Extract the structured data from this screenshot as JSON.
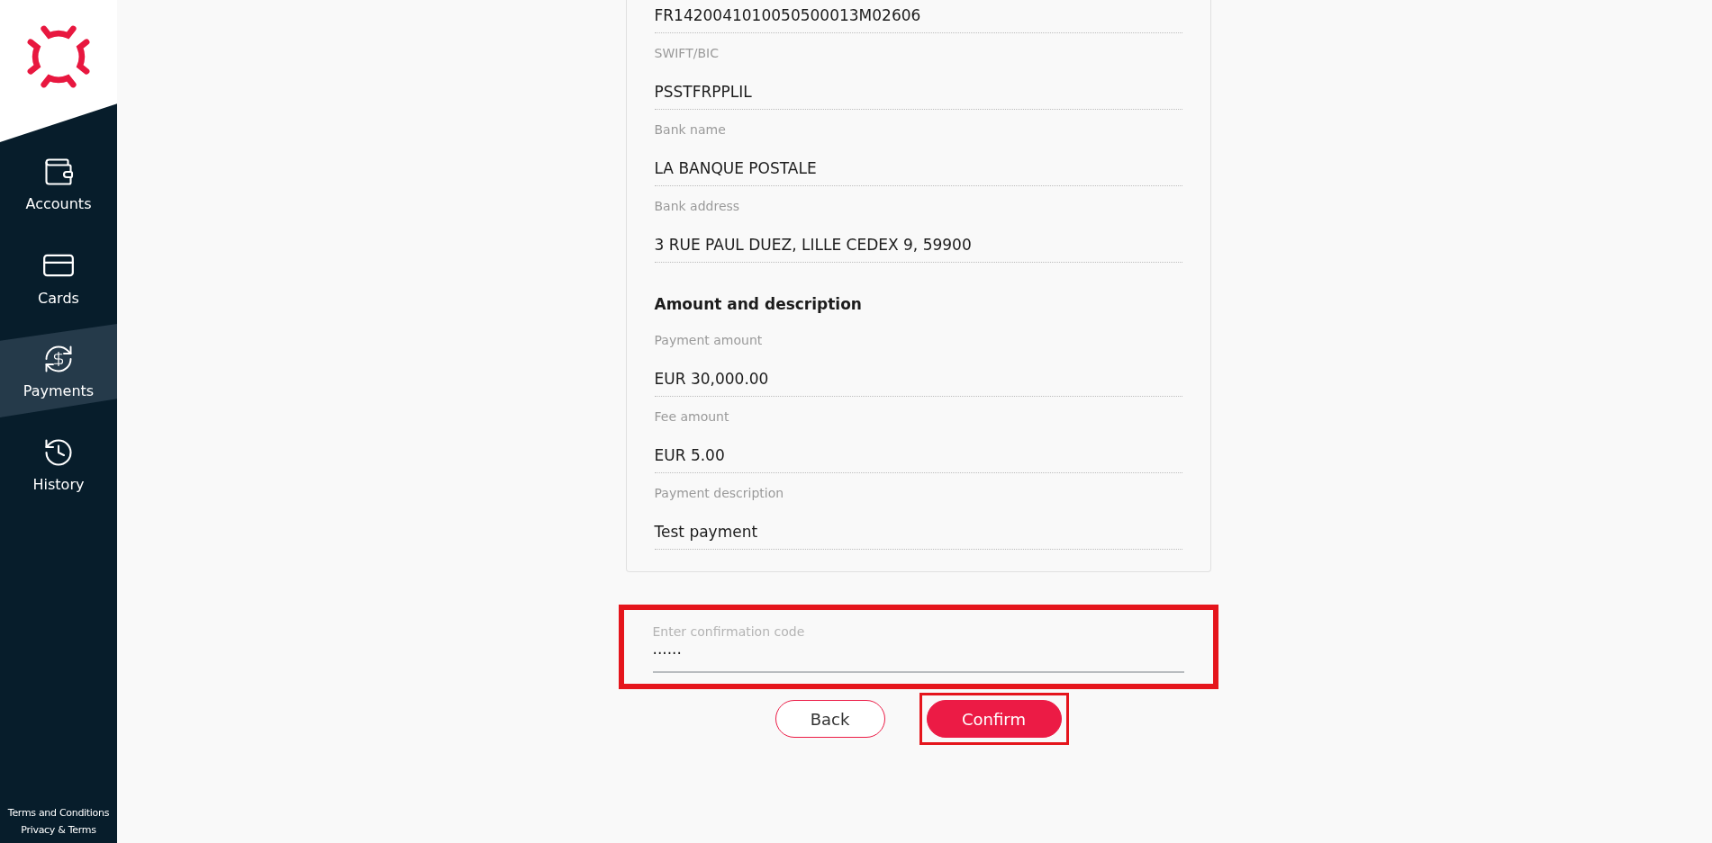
{
  "sidebar": {
    "items": [
      {
        "label": "Accounts",
        "selected": false
      },
      {
        "label": "Cards",
        "selected": false
      },
      {
        "label": "Payments",
        "selected": true
      },
      {
        "label": "History",
        "selected": false
      }
    ],
    "footer_links": [
      "Terms and Conditions",
      "Privacy & Terms"
    ]
  },
  "details": {
    "rows": [
      {
        "kind": "field",
        "value": "FR1420041010050500013M02606"
      },
      {
        "kind": "field",
        "label": "SWIFT/BIC",
        "value": "PSSTFRPPLIL"
      },
      {
        "kind": "field",
        "label": "Bank name",
        "value": "LA BANQUE POSTALE"
      },
      {
        "kind": "field",
        "label": "Bank address",
        "value": "3 RUE PAUL DUEZ, LILLE CEDEX 9, 59900"
      },
      {
        "kind": "heading",
        "value": "Amount and description"
      },
      {
        "kind": "field",
        "label": "Payment amount",
        "value": "EUR 30,000.00"
      },
      {
        "kind": "field",
        "label": "Fee amount",
        "value": "EUR 5.00"
      },
      {
        "kind": "field",
        "label": "Payment description",
        "value": "Test payment"
      }
    ]
  },
  "confirmation_field": {
    "label": "Enter confirmation code",
    "value": "······",
    "highlighted": true
  },
  "buttons": [
    {
      "label": "Back",
      "kind": "secondary",
      "highlighted": false
    },
    {
      "label": "Confirm",
      "kind": "primary",
      "highlighted": true
    }
  ]
}
